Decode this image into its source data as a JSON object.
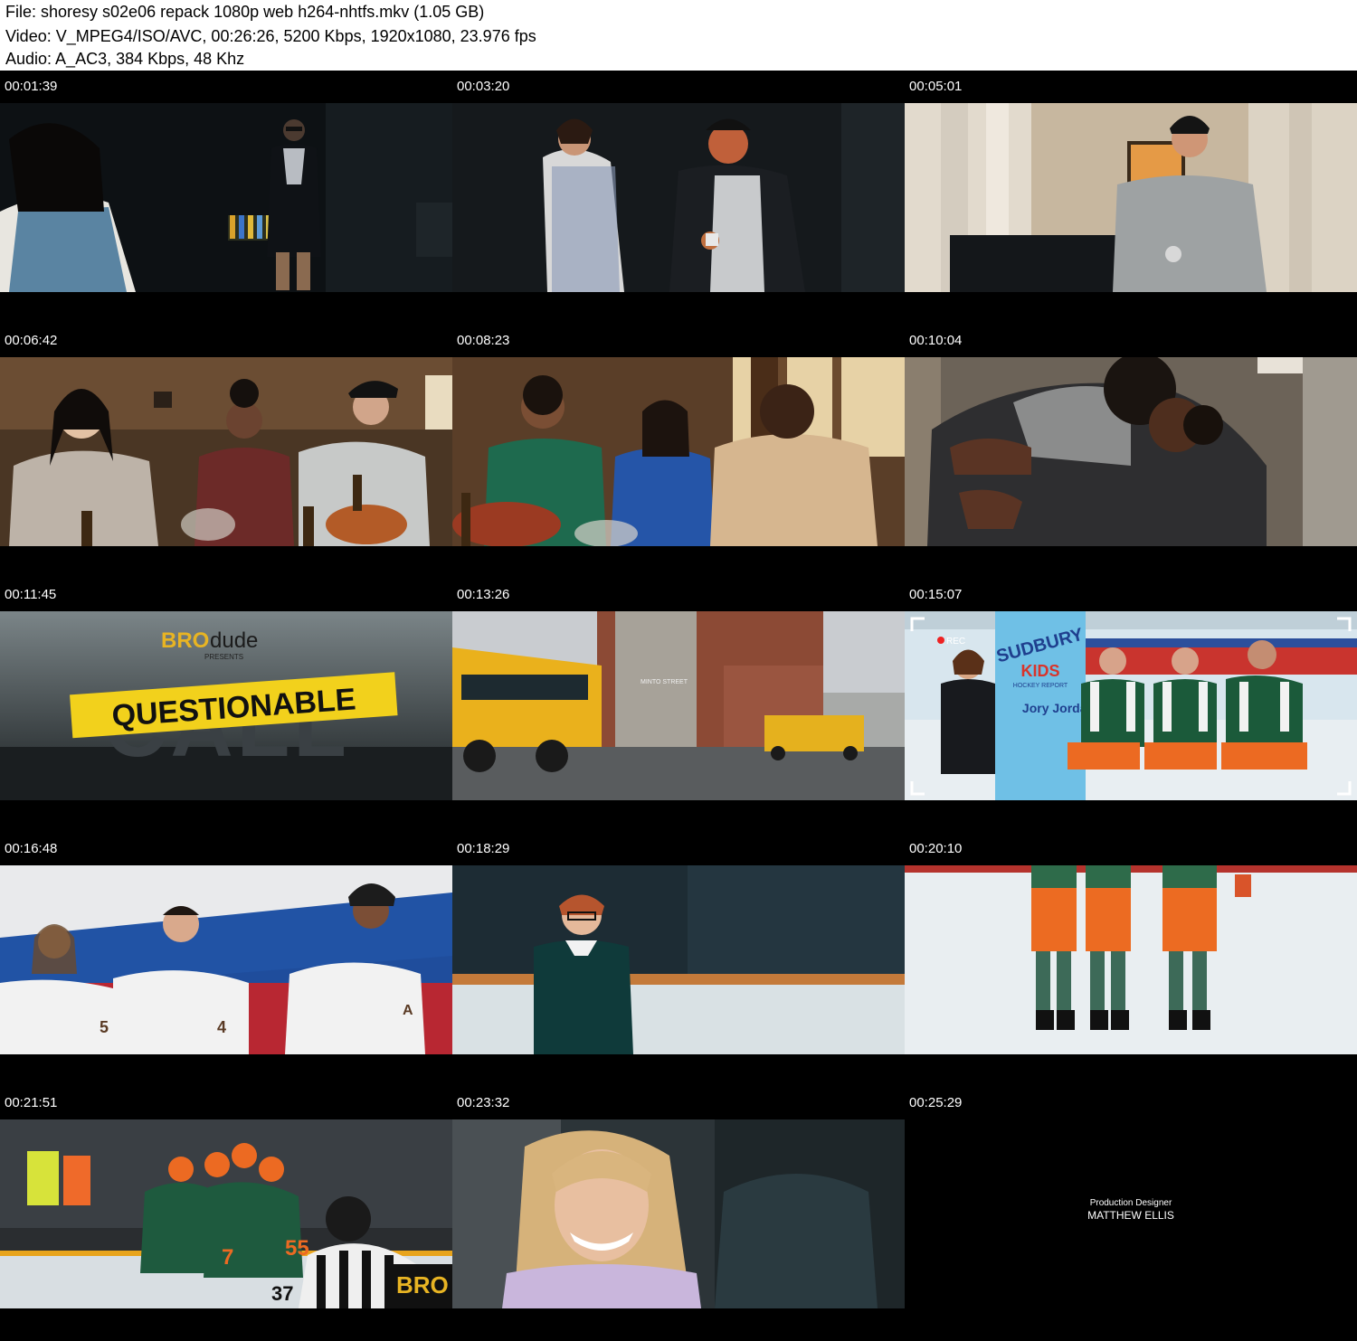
{
  "header": {
    "file_line": "File: shoresy s02e06 repack 1080p web h264-nhtfs.mkv (1.05 GB)",
    "video_line": "Video: V_MPEG4/ISO/AVC, 00:26:26, 5200 Kbps, 1920x1080, 23.976 fps",
    "audio_line": "Audio: A_AC3, 384 Kbps, 48 Khz"
  },
  "thumbnails": [
    {
      "timestamp": "00:01:39"
    },
    {
      "timestamp": "00:03:20"
    },
    {
      "timestamp": "00:05:01"
    },
    {
      "timestamp": "00:06:42"
    },
    {
      "timestamp": "00:08:23"
    },
    {
      "timestamp": "00:10:04"
    },
    {
      "timestamp": "00:11:45",
      "overlay_text": {
        "brand": "BRO",
        "brand2": "dude",
        "presents": "PRESENTS",
        "title1": "QUESTIONABLE",
        "title2": "CALL"
      }
    },
    {
      "timestamp": "00:13:26",
      "overlay_text": {
        "sign": "MINTO STREET"
      }
    },
    {
      "timestamp": "00:15:07",
      "overlay_text": {
        "rec": "REC",
        "banner1": "SUDBURY",
        "banner2": "KIDS",
        "banner3": "HOCKEY REPORT",
        "banner4": "Jory Jordan"
      }
    },
    {
      "timestamp": "00:16:48",
      "overlay_text": {
        "jersey1": "5",
        "jersey2": "4",
        "jersey3": "A"
      }
    },
    {
      "timestamp": "00:18:29"
    },
    {
      "timestamp": "00:20:10"
    },
    {
      "timestamp": "00:21:51",
      "overlay_text": {
        "jersey1": "7",
        "jersey2": "55",
        "jersey3": "37",
        "board": "BRO"
      }
    },
    {
      "timestamp": "00:23:32"
    },
    {
      "timestamp": "00:25:29",
      "credit_role": "Production Designer",
      "credit_name": "MATTHEW ELLIS"
    }
  ]
}
